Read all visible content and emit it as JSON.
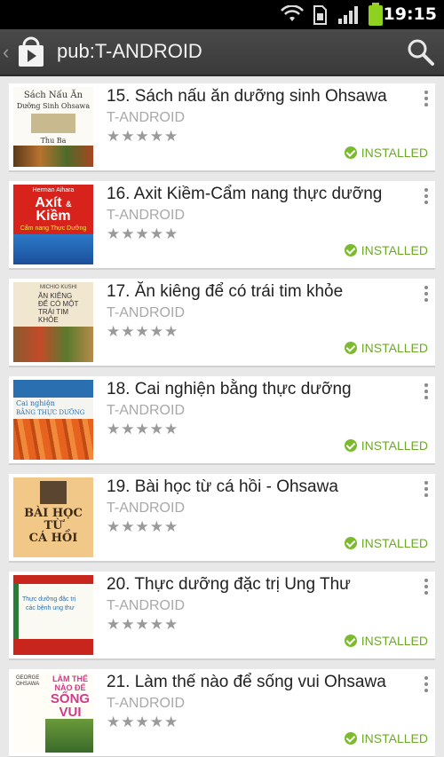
{
  "status_bar": {
    "time": "19:15",
    "icons": [
      "wifi-icon",
      "sim-icon",
      "signal-icon",
      "battery-icon"
    ]
  },
  "action_bar": {
    "title": "pub:T-ANDROID",
    "icons": [
      "back-chevron-icon",
      "play-store-logo-icon",
      "search-icon"
    ]
  },
  "colors": {
    "installed_green": "#6da82a",
    "action_bar": "#404040",
    "background": "#e8e8e8"
  },
  "items": [
    {
      "title": "15. Sách nấu ăn dưỡng sinh Ohsawa",
      "publisher": "T-ANDROID",
      "rating": "★★★★★",
      "status": "INSTALLED",
      "cover_lines": [
        "Sách Nấu Ăn",
        "Dưỡng Sinh Ohsawa",
        "Thu Ba"
      ]
    },
    {
      "title": "16. Axit Kiềm-Cẩm nang thực dưỡng",
      "publisher": "T-ANDROID",
      "rating": "★★★★★",
      "status": "INSTALLED",
      "cover_lines": [
        "Herman Aihara",
        "Axít",
        "&",
        "Kiềm",
        "Cẩm nang Thực Dưỡng"
      ]
    },
    {
      "title": "17. Ăn kiêng để có trái tim khỏe",
      "publisher": "T-ANDROID",
      "rating": "★★★★★",
      "status": "INSTALLED",
      "cover_lines": [
        "MICHIO KUSHI",
        "ĂN KIÊNG",
        "ĐỂ CÓ MỘT",
        "TRÁI TIM",
        "KHỎE"
      ]
    },
    {
      "title": "18. Cai nghiện bằng thực dưỡng",
      "publisher": "T-ANDROID",
      "rating": "★★★★★",
      "status": "INSTALLED",
      "cover_lines": [
        "Cai nghiện",
        "BẰNG THỰC DƯỠNG"
      ]
    },
    {
      "title": "19. Bài học từ cá hồi - Ohsawa",
      "publisher": "T-ANDROID",
      "rating": "★★★★★",
      "status": "INSTALLED",
      "cover_lines": [
        "BÀI HỌC",
        "TỪ",
        "CÁ HỒI"
      ]
    },
    {
      "title": "20. Thực dưỡng đặc trị Ung Thư",
      "publisher": "T-ANDROID",
      "rating": "★★★★★",
      "status": "INSTALLED",
      "cover_lines": [
        "Thực dưỡng đặc trị",
        "các bệnh ung thư"
      ]
    },
    {
      "title": "21. Làm thế nào để sống vui Ohsawa",
      "publisher": "T-ANDROID",
      "rating": "★★★★★",
      "status": "INSTALLED",
      "cover_lines": [
        "GEORGE OHSAWA",
        "LÀM THẾ",
        "NÀO ĐỂ",
        "SỐNG",
        "VUI"
      ]
    }
  ]
}
